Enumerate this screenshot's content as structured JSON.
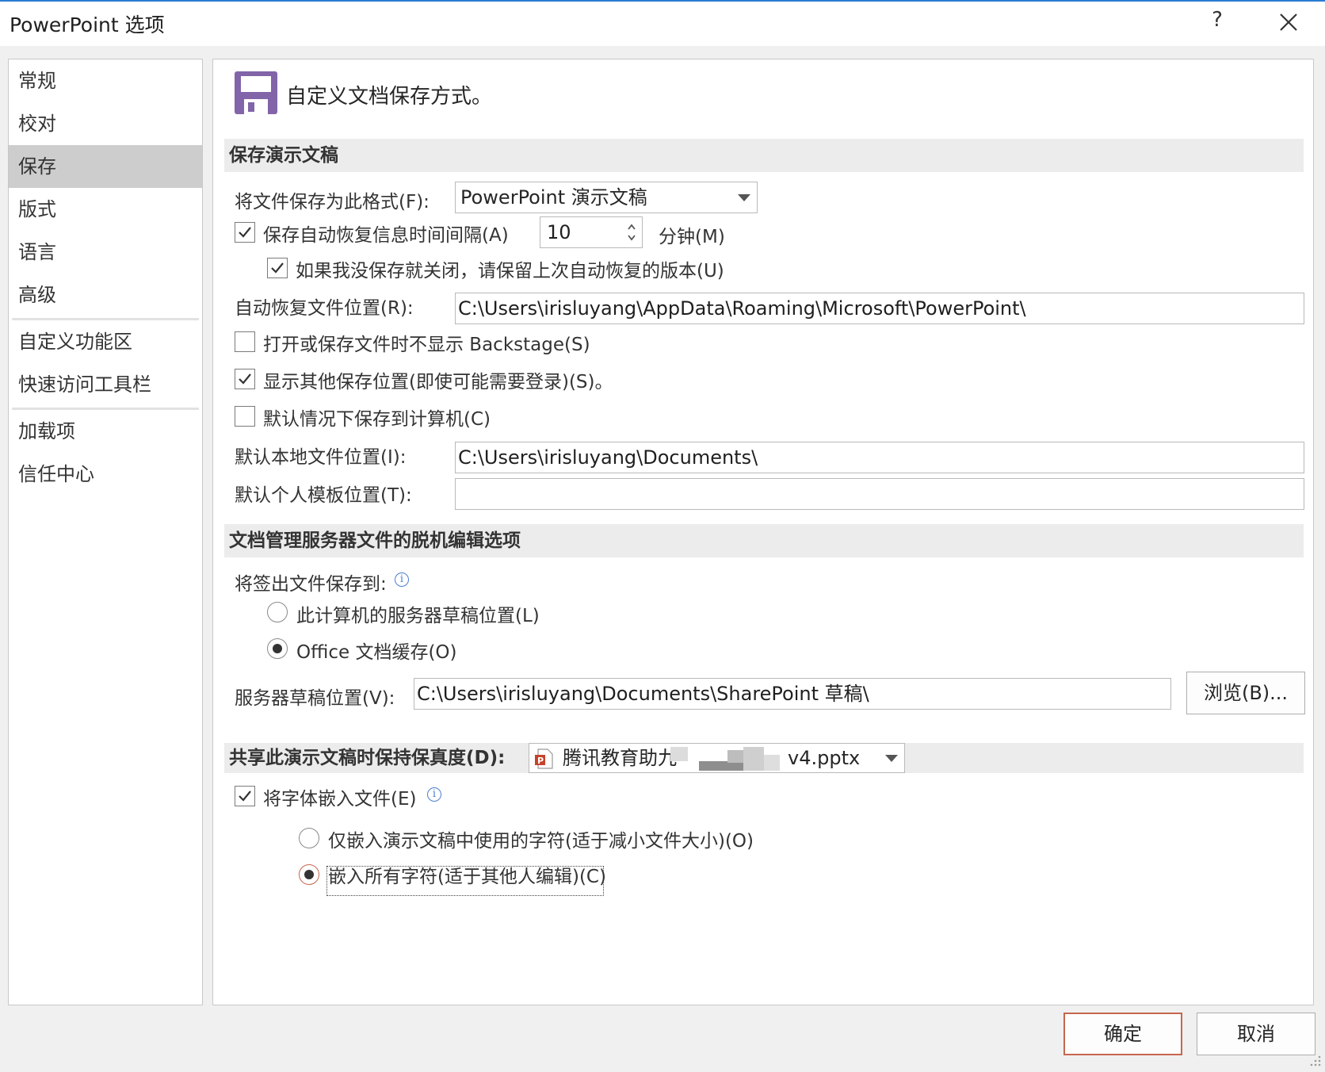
{
  "window": {
    "title": "PowerPoint 选项",
    "help_label": "?",
    "close_icon": "close-icon"
  },
  "nav": {
    "items": [
      {
        "label": "常规"
      },
      {
        "label": "校对"
      },
      {
        "label": "保存",
        "selected": true
      },
      {
        "label": "版式"
      },
      {
        "label": "语言"
      },
      {
        "label": "高级"
      },
      {
        "label": "自定义功能区"
      },
      {
        "label": "快速访问工具栏"
      },
      {
        "label": "加载项"
      },
      {
        "label": "信任中心"
      }
    ]
  },
  "header": {
    "icon": "floppy-disk-icon",
    "accent_color": "#8264a8",
    "text": "自定义文档保存方式。"
  },
  "save_section": {
    "title": "保存演示文稿",
    "format_label": "将文件保存为此格式(F):",
    "format_value": "PowerPoint 演示文稿",
    "autorecover_label": "保存自动恢复信息时间间隔(A)",
    "autorecover_checked": true,
    "autorecover_minutes": "10",
    "minutes_label": "分钟(M)",
    "keep_last_label": "如果我没保存就关闭，请保留上次自动恢复的版本(U)",
    "keep_last_checked": true,
    "autorecover_location_label": "自动恢复文件位置(R):",
    "autorecover_location_value": "C:\\Users\\irisluyang\\AppData\\Roaming\\Microsoft\\PowerPoint\\",
    "no_backstage_label": "打开或保存文件时不显示 Backstage(S)",
    "no_backstage_checked": false,
    "show_additional_label": "显示其他保存位置(即使可能需要登录)(S)。",
    "show_additional_checked": true,
    "save_to_computer_label": "默认情况下保存到计算机(C)",
    "save_to_computer_checked": false,
    "default_local_label": "默认本地文件位置(I):",
    "default_local_value": "C:\\Users\\irisluyang\\Documents\\",
    "template_label": "默认个人模板位置(T):",
    "template_value": ""
  },
  "offline_section": {
    "title": "文档管理服务器文件的脱机编辑选项",
    "save_checked_out_label": "将签出文件保存到:",
    "info_icon": "info-icon",
    "radio_server_label": "此计算机的服务器草稿位置(L)",
    "radio_cache_label": "Office 文档缓存(O)",
    "selected": "cache",
    "drafts_label": "服务器草稿位置(V):",
    "drafts_value": "C:\\Users\\irisluyang\\Documents\\SharePoint 草稿\\",
    "browse_label": "浏览(B)..."
  },
  "fidelity_section": {
    "title": "共享此演示文稿时保持保真度(D):",
    "file_icon": "powerpoint-file-icon",
    "file_prefix": "腾讯教育助九",
    "file_suffix": "v4.pptx",
    "embed_label": "将字体嵌入文件(E)",
    "embed_checked": true,
    "radio_used_label": "仅嵌入演示文稿中使用的字符(适于减小文件大小)(O)",
    "radio_all_label": "嵌入所有字符(适于其他人编辑)(C)",
    "selected": "all"
  },
  "footer": {
    "ok_label": "确定",
    "cancel_label": "取消",
    "ok_accent": "#c5674d"
  }
}
